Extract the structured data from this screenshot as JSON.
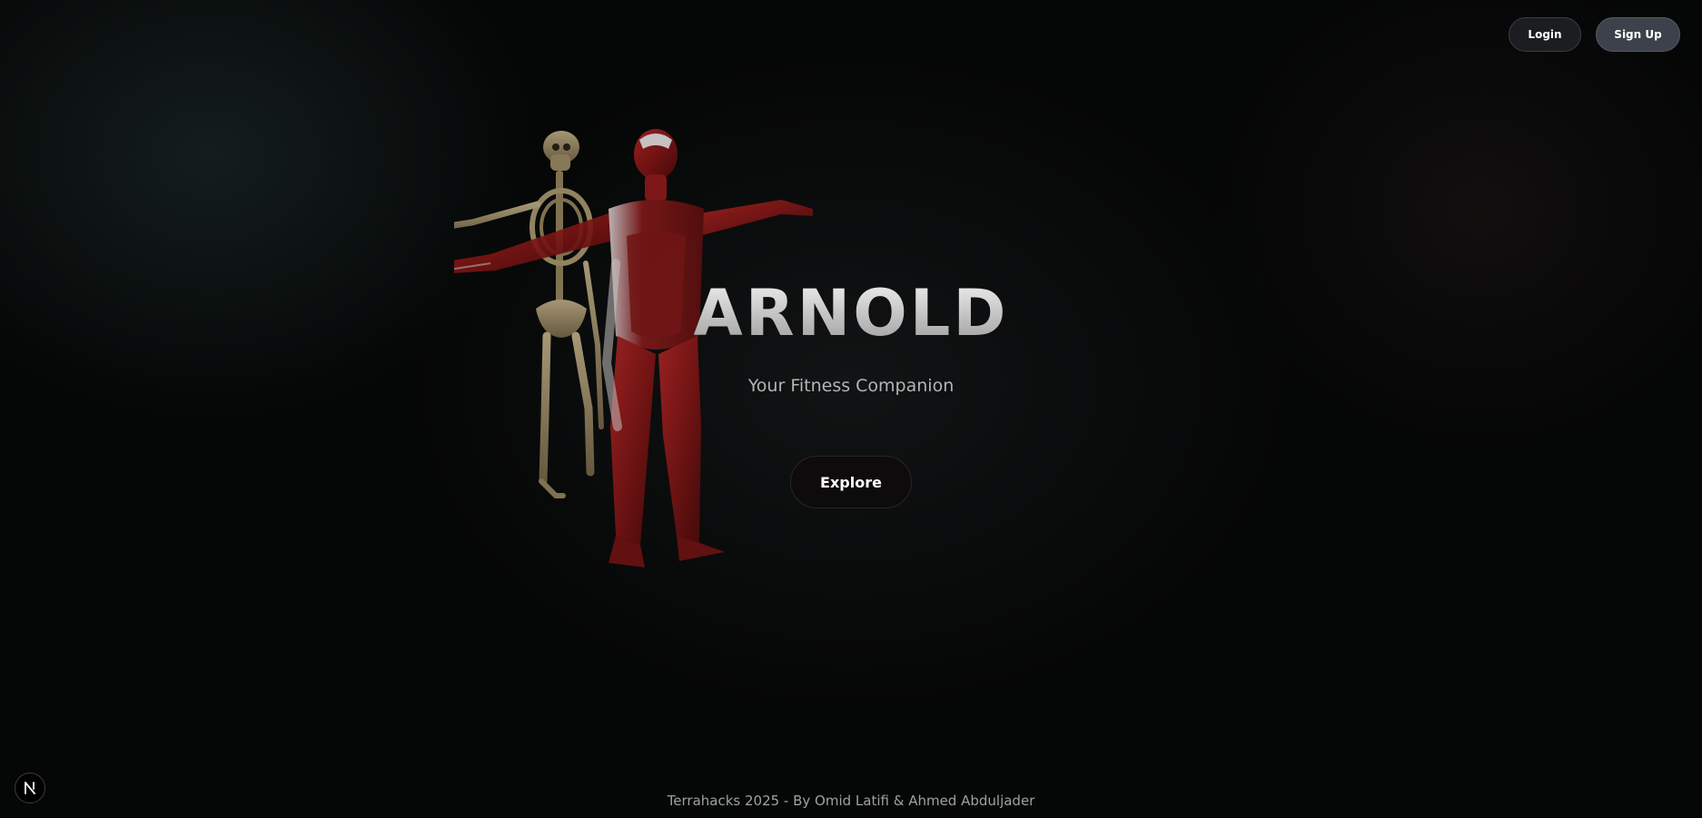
{
  "header": {
    "login_label": "Login",
    "signup_label": "Sign Up"
  },
  "hero": {
    "title": "ARNOLD",
    "subtitle": "Your Fitness Companion",
    "explore_label": "Explore",
    "model_icon": "anatomy-model-skeleton-muscles"
  },
  "footer": {
    "credit": "Terrahacks 2025 - By Omid Latifi & Ahmed Abduljader"
  },
  "dev_badge": {
    "icon": "nextjs-n-icon"
  },
  "colors": {
    "background": "#050606",
    "muscle": "#8e1c1c",
    "bone": "#c9b68a",
    "signup_bg": "#3c414b",
    "login_bg": "#1b1d20"
  }
}
